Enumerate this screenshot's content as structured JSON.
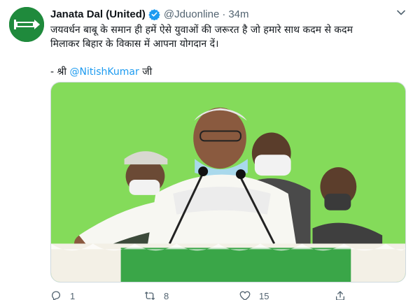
{
  "tweet": {
    "author_name": "Janata Dal (United)",
    "handle": "@Jduonline",
    "separator": "·",
    "time": "34m",
    "line1": "जयवर्धन बाबू के समान ही हमें ऐसे युवाओं की जरूरत है जो हमारे साथ कदम से कदम",
    "line2": "मिलाकर बिहार के विकास में आपना योगदान दें।",
    "attribution_prefix": "- श्री ",
    "mention": "@NitishKumar",
    "attribution_suffix": " जी"
  },
  "actions": {
    "reply_count": "1",
    "retweet_count": "8",
    "like_count": "15"
  },
  "icons": {
    "avatar": "jdu-arrow-logo-icon",
    "verified": "verified-badge-icon",
    "menu": "chevron-down-icon",
    "reply": "reply-icon",
    "retweet": "retweet-icon",
    "like": "heart-icon",
    "share": "share-icon"
  },
  "colors": {
    "link": "#1d9bf0",
    "muted": "#536471",
    "avatar_bg": "#1f8a3c",
    "stage_bg": "#7ed957"
  }
}
